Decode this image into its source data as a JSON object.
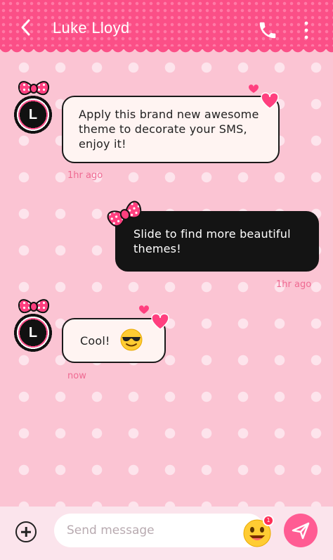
{
  "header": {
    "title": "Luke Lloyd",
    "back_icon": "chevron-left-icon",
    "call_icon": "phone-icon",
    "menu_icon": "more-vertical-icon"
  },
  "messages": [
    {
      "direction": "incoming",
      "avatar_letter": "L",
      "text": "Apply this brand new awesome theme to decorate your SMS, enjoy it!",
      "time": "1hr ago"
    },
    {
      "direction": "outgoing",
      "text": "Slide to find more beautiful themes!",
      "time": "1hr ago"
    },
    {
      "direction": "incoming",
      "avatar_letter": "L",
      "text": "Cool!",
      "emoji": "smiling-face-with-sunglasses",
      "time": "now"
    }
  ],
  "composer": {
    "placeholder": "Send message",
    "value": "",
    "add_icon": "plus-circle-icon",
    "emoji_icon": "emoji-icon",
    "emoji_badge": "1",
    "send_icon": "send-icon"
  },
  "colors": {
    "header": "#fb4f87",
    "background": "#fbc4d3",
    "accent": "#ff5c93",
    "time_text": "#ef6a92",
    "bubble_light": "#fff4f2",
    "bubble_dark": "#141414"
  }
}
